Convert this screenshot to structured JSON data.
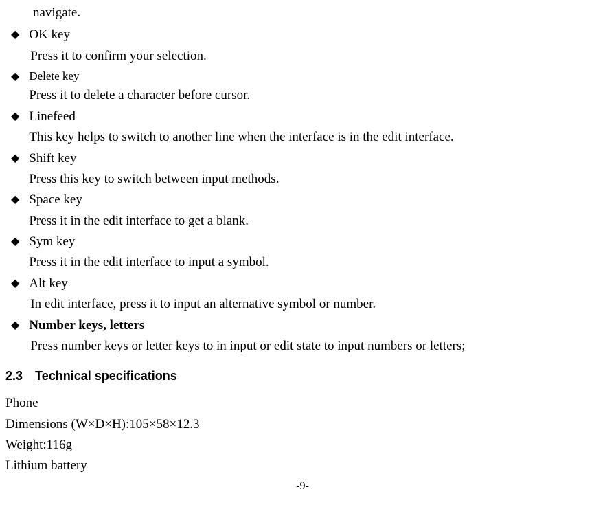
{
  "navigate_tail": "navigate.",
  "items": [
    {
      "term": "OK key",
      "desc": "Press it to confirm your selection.",
      "desc_indent": true
    },
    {
      "term": "Delete key",
      "term_small": true,
      "desc": "Press it to delete a character before cursor."
    },
    {
      "term": "Linefeed",
      "desc": "This key helps to switch to another line when the interface is in the edit interface."
    },
    {
      "term": "Shift key",
      "desc": "Press this key to switch between input methods."
    },
    {
      "term": "Space key",
      "desc": "Press it in the edit interface to get a blank."
    },
    {
      "term": "Sym key",
      "desc": "Press it in the edit interface to input a symbol."
    },
    {
      "term": "Alt key",
      "desc": "In edit interface, press it to input an alternative symbol or number.",
      "desc_indent": true
    },
    {
      "term": "Number keys, letters",
      "term_bold": true,
      "desc": "Press number keys or letter keys to in input or edit state to input numbers or letters;",
      "desc_indent": true
    }
  ],
  "section": {
    "number": "2.3",
    "title": "Technical specifications"
  },
  "specs": [
    "Phone",
    "Dimensions (W×D×H):105×58×12.3",
    "Weight:116g",
    "Lithium battery"
  ],
  "page_number": "-9-"
}
